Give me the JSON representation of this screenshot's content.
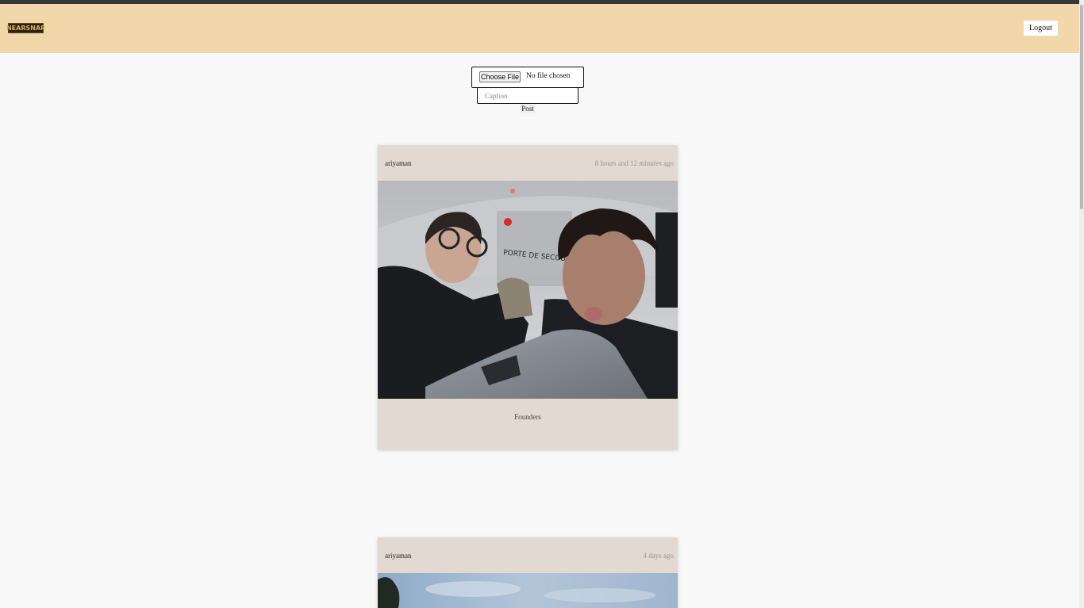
{
  "header": {
    "logo_text": "NEARSNAP",
    "logout_label": "Logout"
  },
  "upload": {
    "choose_file_label": "Choose File",
    "file_status": "No file chosen",
    "caption_placeholder": "Caption",
    "post_label": "Post"
  },
  "posts": [
    {
      "username": "ariyaman",
      "time": "8 hours and 12 minutes ago",
      "caption": "Founders"
    },
    {
      "username": "ariyaman",
      "time": "4 days ago"
    }
  ]
}
